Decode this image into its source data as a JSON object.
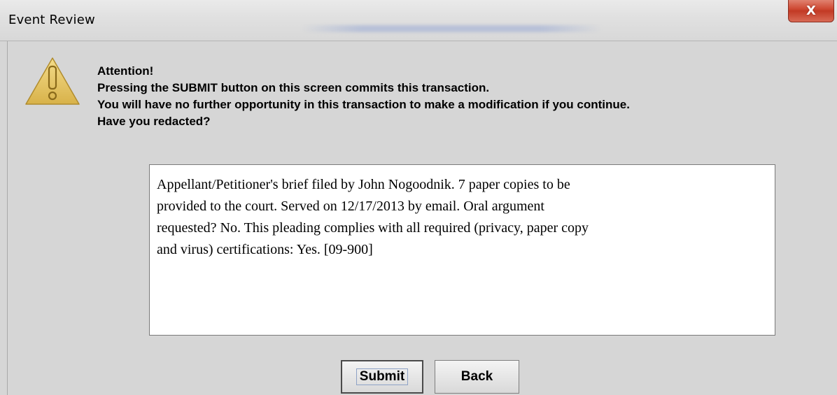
{
  "window": {
    "title": "Event Review",
    "close_label": "X"
  },
  "message": {
    "icon": "warning-triangle-icon",
    "lines": [
      "Attention!",
      "Pressing the SUBMIT button on this screen commits this transaction.",
      "You will have no further opportunity in this transaction to make a modification if you continue.",
      "Have you redacted?"
    ]
  },
  "docket_text": {
    "lines": [
      "Appellant/Petitioner's brief filed by John Nogoodnik. 7 paper copies to be",
      "provided to the court. Served on 12/17/2013 by email. Oral argument",
      "requested? No. This pleading complies with all required (privacy, paper copy",
      "and virus) certifications: Yes. [09-900]"
    ]
  },
  "buttons": {
    "submit_label": "Submit",
    "back_label": "Back"
  },
  "colors": {
    "dialog_background": "#d6d6d6",
    "close_button": "#c23a25",
    "warning_icon": "#e2c05a"
  }
}
